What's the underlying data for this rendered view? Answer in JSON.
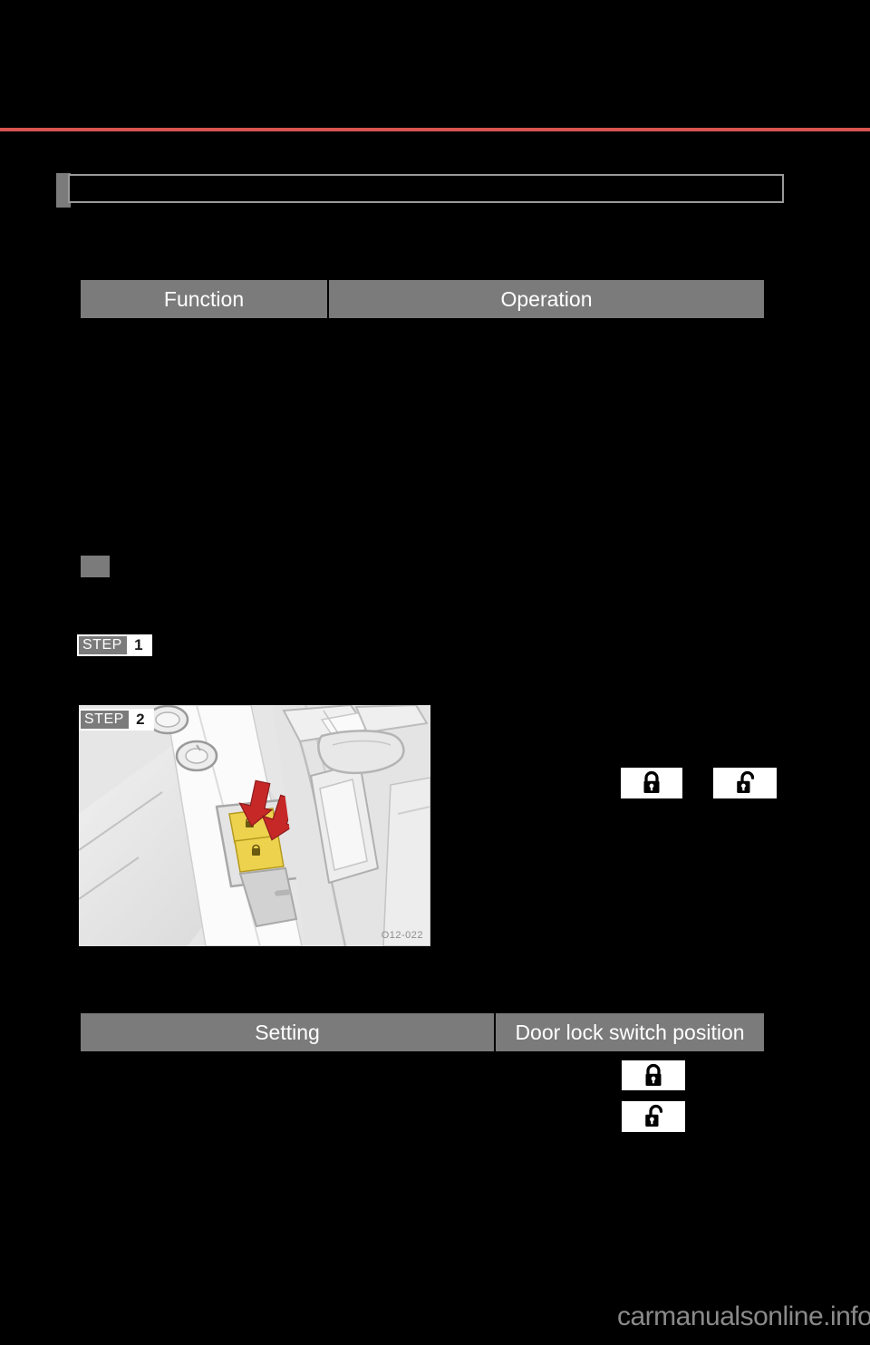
{
  "page": {
    "background_color": "#000000",
    "accent_rule_color": "#d9534f",
    "header_band_color": "#7b7b7b",
    "text_color": "#ffffff"
  },
  "section_header": {
    "title": ""
  },
  "table_function_operation": {
    "headers": {
      "col1": "Function",
      "col2": "Operation"
    },
    "rows": []
  },
  "bullet_section": {
    "heading": ""
  },
  "steps": [
    {
      "word": "STEP",
      "number": "1",
      "text": ""
    },
    {
      "word": "STEP",
      "number": "2",
      "text": ""
    }
  ],
  "illustration": {
    "caption_id": "O12-022",
    "subject": "door-lock-switch",
    "highlight_color": "#edd24e",
    "arrow_color": "#c62828",
    "background_color": "#e9e9e9"
  },
  "inline_icons": [
    {
      "name": "lock-icon",
      "state": "locked"
    },
    {
      "name": "unlock-icon",
      "state": "unlocked"
    }
  ],
  "table_setting_position": {
    "headers": {
      "col1": "Setting",
      "col2": "Door lock switch position"
    },
    "rows": [
      {
        "setting": "",
        "position_icon": "lock-icon"
      },
      {
        "setting": "",
        "position_icon": "unlock-icon"
      }
    ]
  },
  "footer": {
    "watermark": "carmanualsonline.info"
  }
}
